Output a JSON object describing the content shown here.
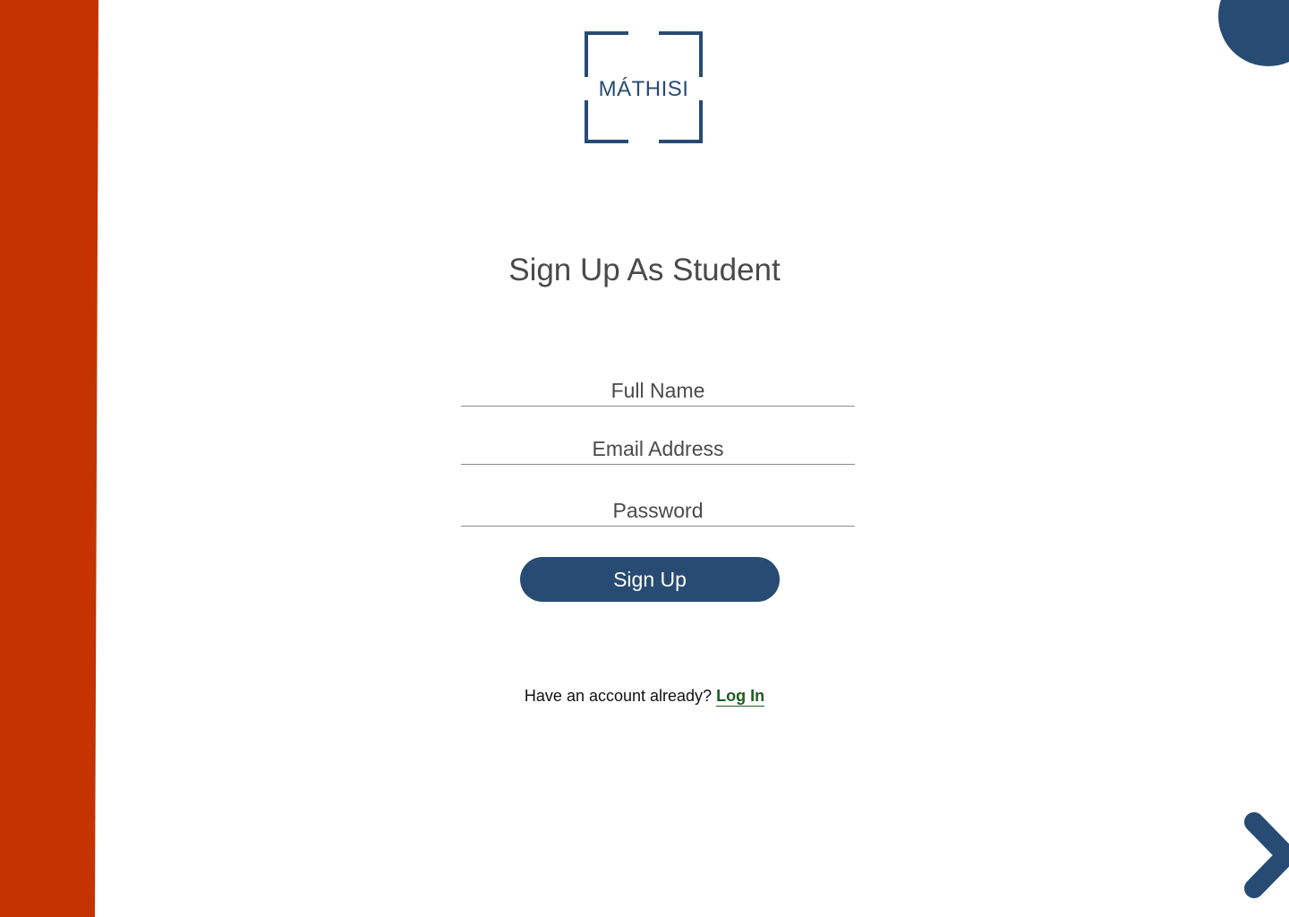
{
  "brand": {
    "logo_text": "MÁTHISI",
    "primary_color": "#274b73",
    "accent_color": "#c43300",
    "link_color": "#1f5c1f"
  },
  "page": {
    "title": "Sign Up As Student"
  },
  "form": {
    "full_name": {
      "placeholder": "Full Name",
      "value": ""
    },
    "email": {
      "placeholder": "Email Address",
      "value": ""
    },
    "password": {
      "placeholder": "Password",
      "value": ""
    },
    "submit_label": "Sign Up"
  },
  "footer": {
    "prompt": "Have an account already?",
    "login_label": "Log In"
  },
  "icons": {
    "next": "chevron-right-icon",
    "logo": "bracket-frame-logo"
  }
}
